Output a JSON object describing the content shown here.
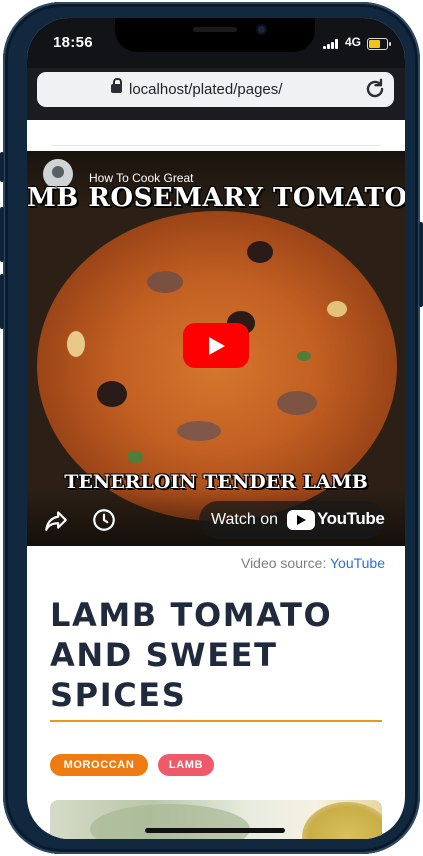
{
  "status_bar": {
    "time": "18:56",
    "network": "4G",
    "battery_level": 0.7,
    "signal_bars": 4
  },
  "browser": {
    "url": "localhost/plated/pages/"
  },
  "video": {
    "channel_title": "How To Cook Great",
    "banner_top": "MB ROSEMARY TOMATO STEW",
    "banner_bottom": "TENERLOIN TENDER LAMB",
    "watch_on": "Watch on",
    "platform": "YouTube"
  },
  "video_source": {
    "label": "Video source:",
    "link": "YouTube"
  },
  "recipe": {
    "title": "LAMB TOMATO AND SWEET SPICES",
    "tags": [
      "MOROCCAN",
      "LAMB"
    ]
  },
  "colors": {
    "accent": "#f0961a",
    "title": "#1f2a3d",
    "tag_moroccan": "#ee7b12",
    "tag_lamb": "#ef5a6a",
    "link": "#2b6fd8",
    "phone_frame": "#11283f"
  }
}
